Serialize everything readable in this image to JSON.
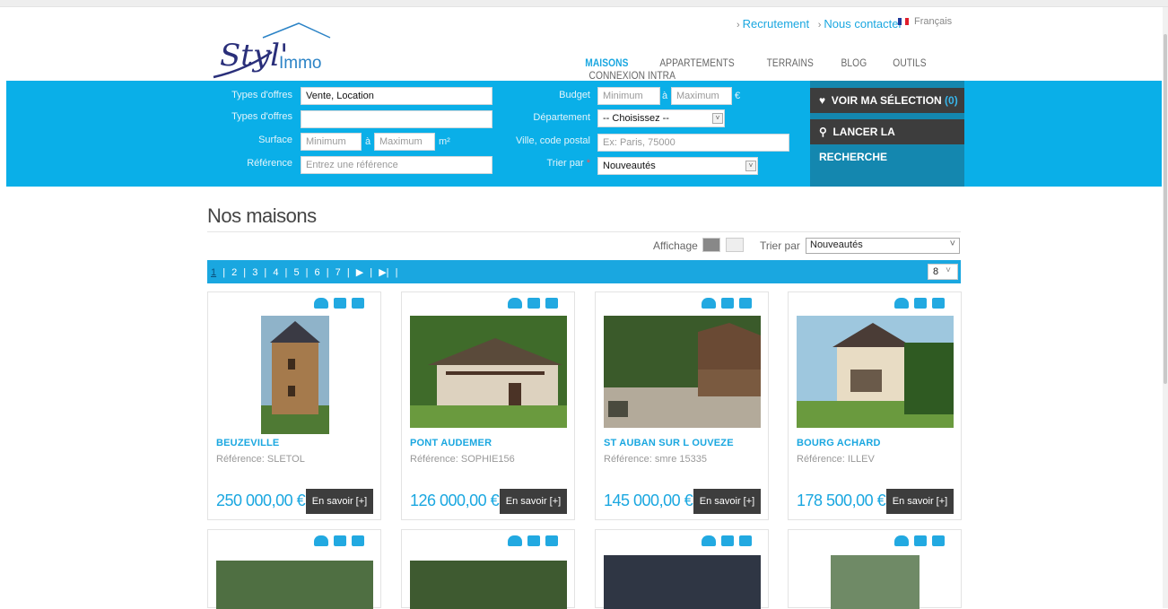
{
  "header": {
    "logo_text_script": "Styl'",
    "logo_text_main": "Immo",
    "top_links": [
      "Recrutement",
      "Nous contacter"
    ],
    "language": "Français",
    "nav": [
      "MAISONS",
      "APPARTEMENTS",
      "TERRAINS",
      "BLOG",
      "OUTILS",
      "CONNEXION INTRA"
    ]
  },
  "search": {
    "types_offres_label": "Types d'offres",
    "types_offres_value": "Vente, Location",
    "types_offres2_label": "Types d'offres",
    "surface_label": "Surface",
    "surface_min": "Minimum",
    "surface_to": "à",
    "surface_max": "Maximum",
    "surface_unit": "m²",
    "reference_label": "Référence",
    "reference_placeholder": "Entrez une référence",
    "budget_label": "Budget",
    "budget_min": "Minimum",
    "budget_to": "à",
    "budget_max": "Maximum",
    "budget_unit": "€",
    "departement_label": "Département",
    "departement_value": "-- Choisissez --",
    "ville_label": "Ville, code postal",
    "ville_placeholder": "Ex: Paris, 75000",
    "trier_label": "Trier par",
    "trier_required": "*",
    "trier_value": "Nouveautés",
    "btn_selection": "VOIR MA SÉLECTION",
    "btn_selection_count": "(0)",
    "btn_search": "LANCER LA RECHERCHE"
  },
  "listing": {
    "title": "Nos maisons",
    "affichage_label": "Affichage",
    "trier_label": "Trier par",
    "trier_value": "Nouveautés",
    "pages": [
      "1",
      "|",
      "2",
      "|",
      "3",
      "|",
      "4",
      "|",
      "5",
      "|",
      "6",
      "|",
      "7",
      "|",
      "▶",
      "|",
      "▶|",
      "|"
    ],
    "per_page": "8",
    "cards": [
      {
        "city": "BEUZEVILLE",
        "ref": "Référence: SLETOL",
        "price": "250 000,00 €",
        "more": "En savoir [+]"
      },
      {
        "city": "PONT AUDEMER",
        "ref": "Référence: SOPHIE156",
        "price": "126 000,00 €",
        "more": "En savoir [+]"
      },
      {
        "city": "ST AUBAN SUR L OUVEZE",
        "ref": "Référence: smre 15335",
        "price": "145 000,00 €",
        "more": "En savoir [+]"
      },
      {
        "city": "BOURG ACHARD",
        "ref": "Référence: ILLEV",
        "price": "178 500,00 €",
        "more": "En savoir [+]"
      }
    ]
  },
  "colors": {
    "accent": "#1aa7e0",
    "band": "#0aafe8",
    "dark_button": "#3d3d3d"
  }
}
